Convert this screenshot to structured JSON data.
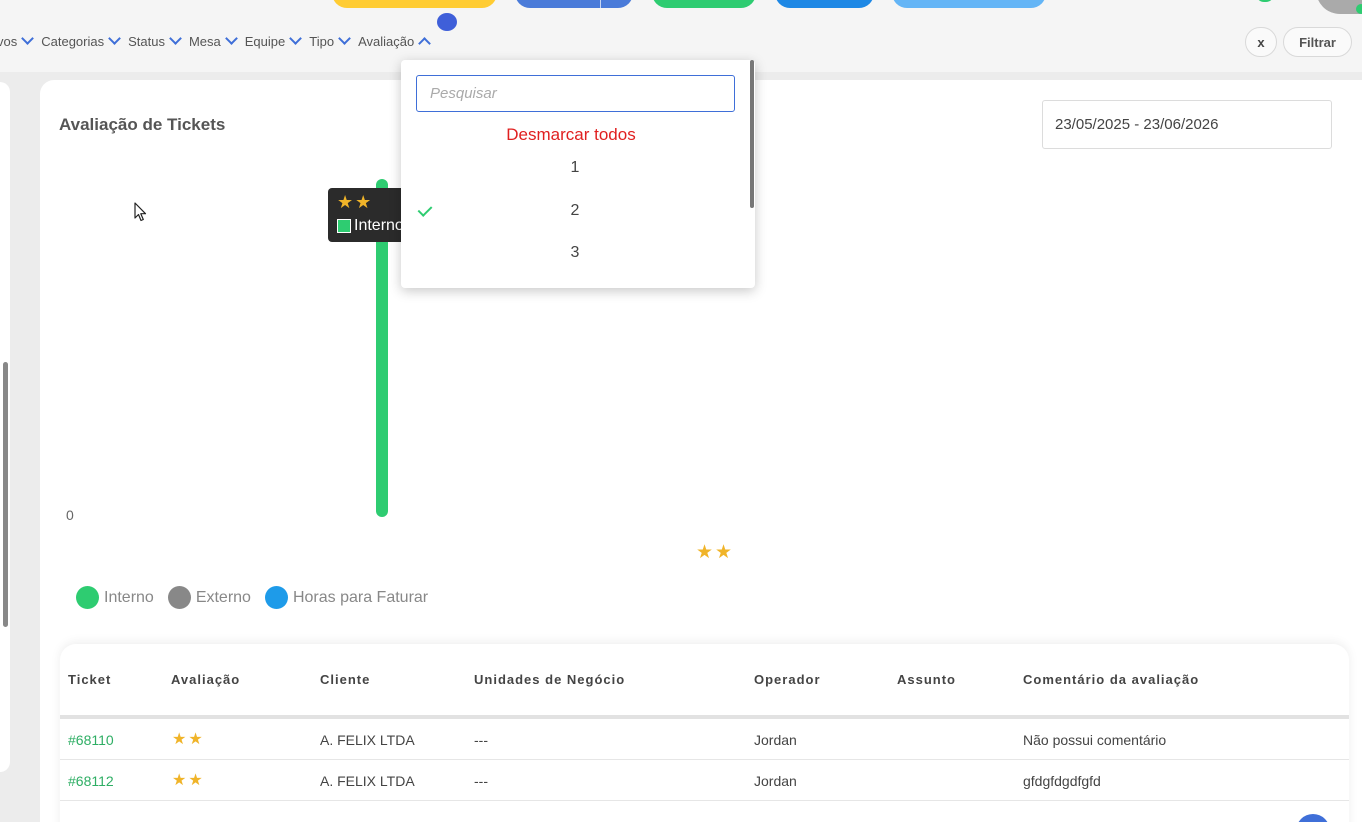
{
  "filters": [
    {
      "label": "vos",
      "open": false
    },
    {
      "label": "Categorias",
      "open": false
    },
    {
      "label": "Status",
      "open": false
    },
    {
      "label": "Mesa",
      "open": false
    },
    {
      "label": "Equipe",
      "open": false
    },
    {
      "label": "Tipo",
      "open": false
    },
    {
      "label": "Avaliação",
      "open": true
    }
  ],
  "toolbar": {
    "clear_label": "x",
    "filter_label": "Filtrar"
  },
  "card": {
    "title": "Avaliação de Tickets",
    "date_range": "23/05/2025 - 23/06/2026"
  },
  "dropdown": {
    "search_placeholder": "Pesquisar",
    "clear_all_label": "Desmarcar todos",
    "options": [
      {
        "label": "1",
        "checked": false
      },
      {
        "label": "2",
        "checked": true
      },
      {
        "label": "3",
        "checked": false
      }
    ]
  },
  "chart_data": {
    "type": "bar",
    "categories": [
      "★★"
    ],
    "series": [
      {
        "name": "Interno",
        "color": "#2ecc71"
      },
      {
        "name": "Externo",
        "color": "#888888"
      },
      {
        "name": "Horas para Faturar",
        "color": "#1e9be9"
      }
    ],
    "y_tick_labels": [
      "0"
    ],
    "tooltip": {
      "stars": "★★",
      "series": "Interno"
    }
  },
  "table": {
    "columns": [
      "Ticket",
      "Avaliação",
      "Cliente",
      "Unidades de Negócio",
      "Operador",
      "Assunto",
      "Comentário da avaliação"
    ],
    "rows": [
      {
        "ticket": "#68110",
        "rating": "★★",
        "client": "A. FELIX LTDA",
        "business_units": "---",
        "operator": "Jordan",
        "subject": "",
        "comment": "Não possui comentário"
      },
      {
        "ticket": "#68112",
        "rating": "★★",
        "client": "A. FELIX LTDA",
        "business_units": "---",
        "operator": "Jordan",
        "subject": "",
        "comment": "gfdgfdgdfgfd"
      }
    ]
  }
}
